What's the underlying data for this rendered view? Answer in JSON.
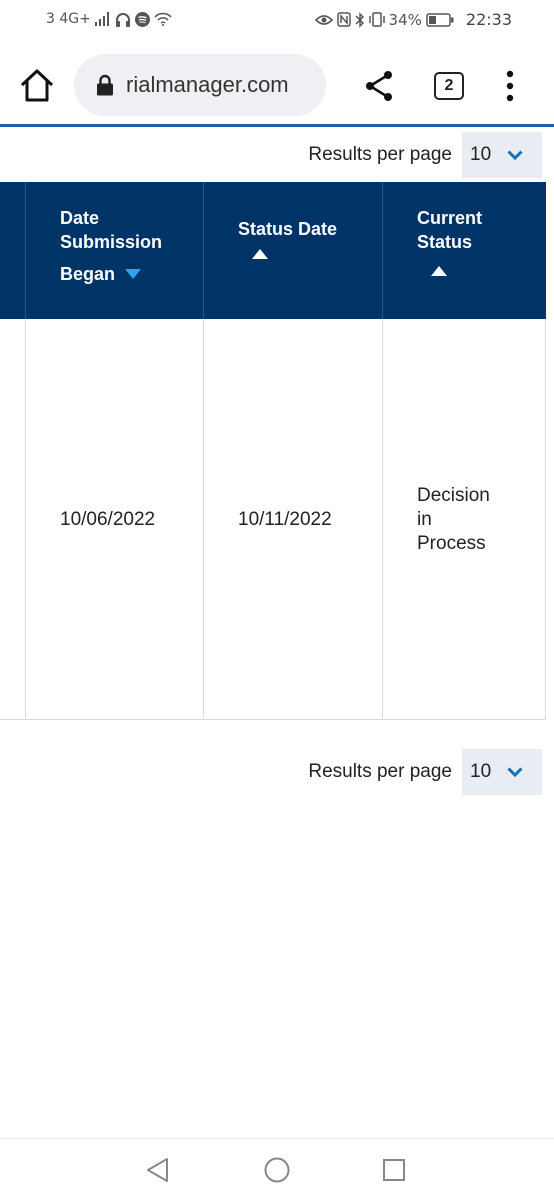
{
  "status_bar": {
    "network": "3 4G+",
    "battery": "34%",
    "time": "22:33"
  },
  "browser": {
    "url": "rialmanager.com",
    "tab_count": "2"
  },
  "pagination": {
    "label": "Results per page",
    "value": "10"
  },
  "table": {
    "columns": [
      {
        "label_lines": [
          "Date",
          "Submission",
          "Began"
        ],
        "sort": "desc-active"
      },
      {
        "label_lines": [
          "Status Date"
        ],
        "sort": "asc"
      },
      {
        "label_lines": [
          "Current",
          "Status"
        ],
        "sort": "asc"
      }
    ],
    "rows": [
      {
        "date_submission_began": "10/06/2022",
        "status_date": "10/11/2022",
        "current_status_lines": [
          "Decision",
          "in",
          "Process"
        ]
      }
    ]
  },
  "icons": {
    "home": "home-icon",
    "lock": "lock-icon",
    "share": "share-icon",
    "menu": "more-vert-icon",
    "chevron": "chevron-down-icon",
    "sort_desc": "sort-desc-icon",
    "sort_asc": "sort-asc-icon",
    "nav_back": "nav-back-icon",
    "nav_home": "nav-home-icon",
    "nav_recent": "nav-recent-icon"
  },
  "colors": {
    "header_bg": "#003366",
    "accent": "#2a5db0",
    "sort_active": "#2ea3f2",
    "select_bg": "#e8edf3"
  }
}
